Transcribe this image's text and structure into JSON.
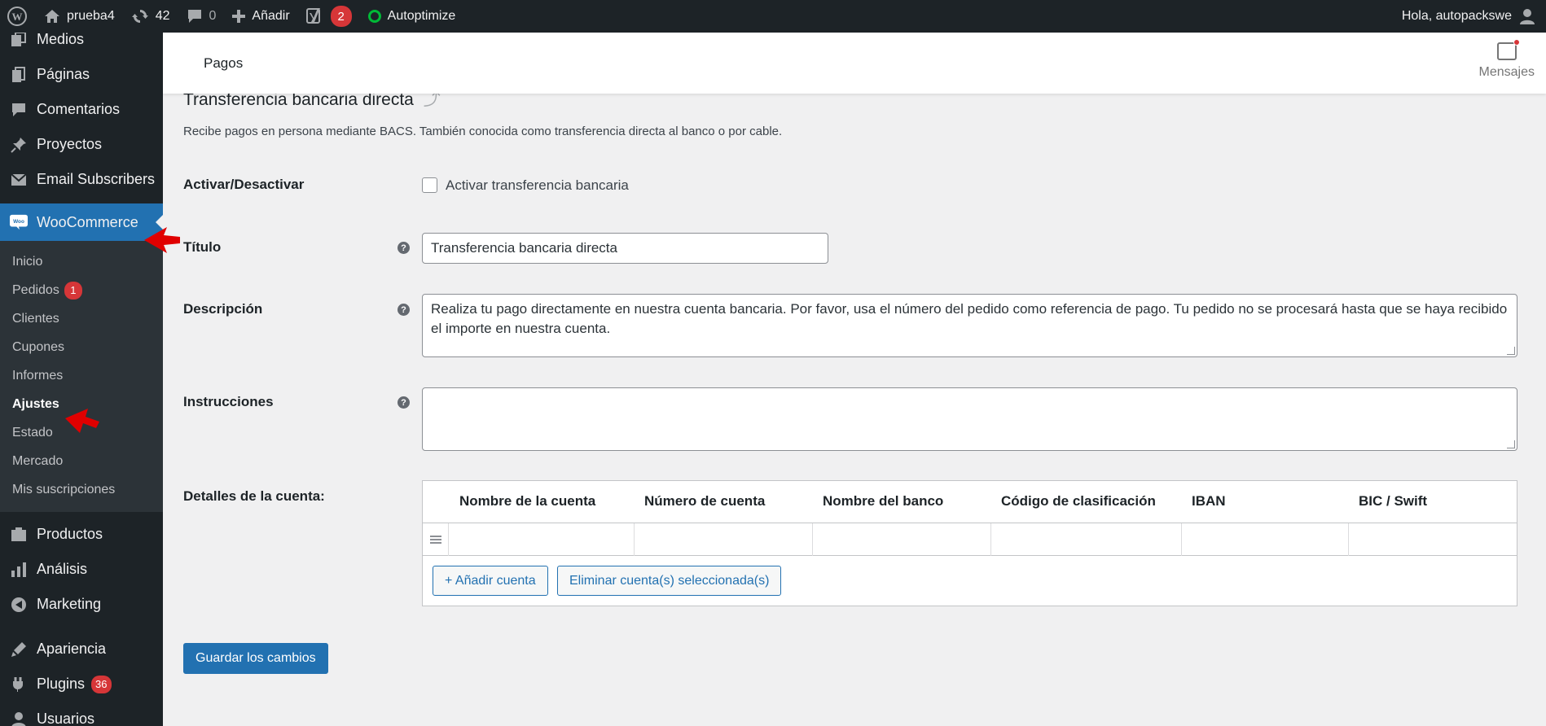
{
  "admin_bar": {
    "site_name": "prueba4",
    "updates_count": "42",
    "comments_count": "0",
    "add_new_label": "Añadir",
    "yoast_count": "2",
    "autoptimize_label": "Autoptimize",
    "greeting": "Hola, autopackswe"
  },
  "sidebar": {
    "items_top": [
      {
        "label": "Medios",
        "icon": "media-icon"
      },
      {
        "label": "Páginas",
        "icon": "pages-icon"
      },
      {
        "label": "Comentarios",
        "icon": "comments-icon"
      },
      {
        "label": "Proyectos",
        "icon": "pin-icon"
      },
      {
        "label": "Email Subscribers",
        "icon": "email-icon"
      }
    ],
    "current": {
      "label": "WooCommerce",
      "icon": "woo-icon"
    },
    "submenu": [
      {
        "label": "Inicio"
      },
      {
        "label": "Pedidos",
        "badge": "1"
      },
      {
        "label": "Clientes"
      },
      {
        "label": "Cupones"
      },
      {
        "label": "Informes"
      },
      {
        "label": "Ajustes",
        "active": true
      },
      {
        "label": "Estado"
      },
      {
        "label": "Mercado"
      },
      {
        "label": "Mis suscripciones"
      }
    ],
    "items_bottom": [
      {
        "label": "Productos",
        "icon": "products-icon"
      },
      {
        "label": "Análisis",
        "icon": "analytics-icon"
      },
      {
        "label": "Marketing",
        "icon": "marketing-icon"
      },
      {
        "label": "Apariencia",
        "icon": "appearance-icon"
      },
      {
        "label": "Plugins",
        "icon": "plugins-icon",
        "badge": "36"
      },
      {
        "label": "Usuarios",
        "icon": "users-icon"
      }
    ]
  },
  "header": {
    "title": "Pagos",
    "inbox_label": "Mensajes"
  },
  "form": {
    "heading": "Transferencia bancaria directa",
    "description": "Recibe pagos en persona mediante BACS. También conocida como transferencia directa al banco o por cable.",
    "enable_label": "Activar/Desactivar",
    "enable_checkbox_label": "Activar transferencia bancaria",
    "title_label": "Título",
    "title_value": "Transferencia bancaria directa",
    "description_label": "Descripción",
    "description_value": "Realiza tu pago directamente en nuestra cuenta bancaria. Por favor, usa el número del pedido como referencia de pago. Tu pedido no se procesará hasta que se haya recibido el importe en nuestra cuenta.",
    "instructions_label": "Instrucciones",
    "instructions_value": "",
    "accounts_label": "Detalles de la cuenta:",
    "accounts_columns": [
      "Nombre de la cuenta",
      "Número de cuenta",
      "Nombre del banco",
      "Código de clasificación",
      "IBAN",
      "BIC / Swift"
    ],
    "add_account_label": "+ Añadir cuenta",
    "remove_account_label": "Eliminar cuenta(s) seleccionada(s)",
    "help_glyph": "?",
    "save_label": "Guardar los cambios"
  }
}
